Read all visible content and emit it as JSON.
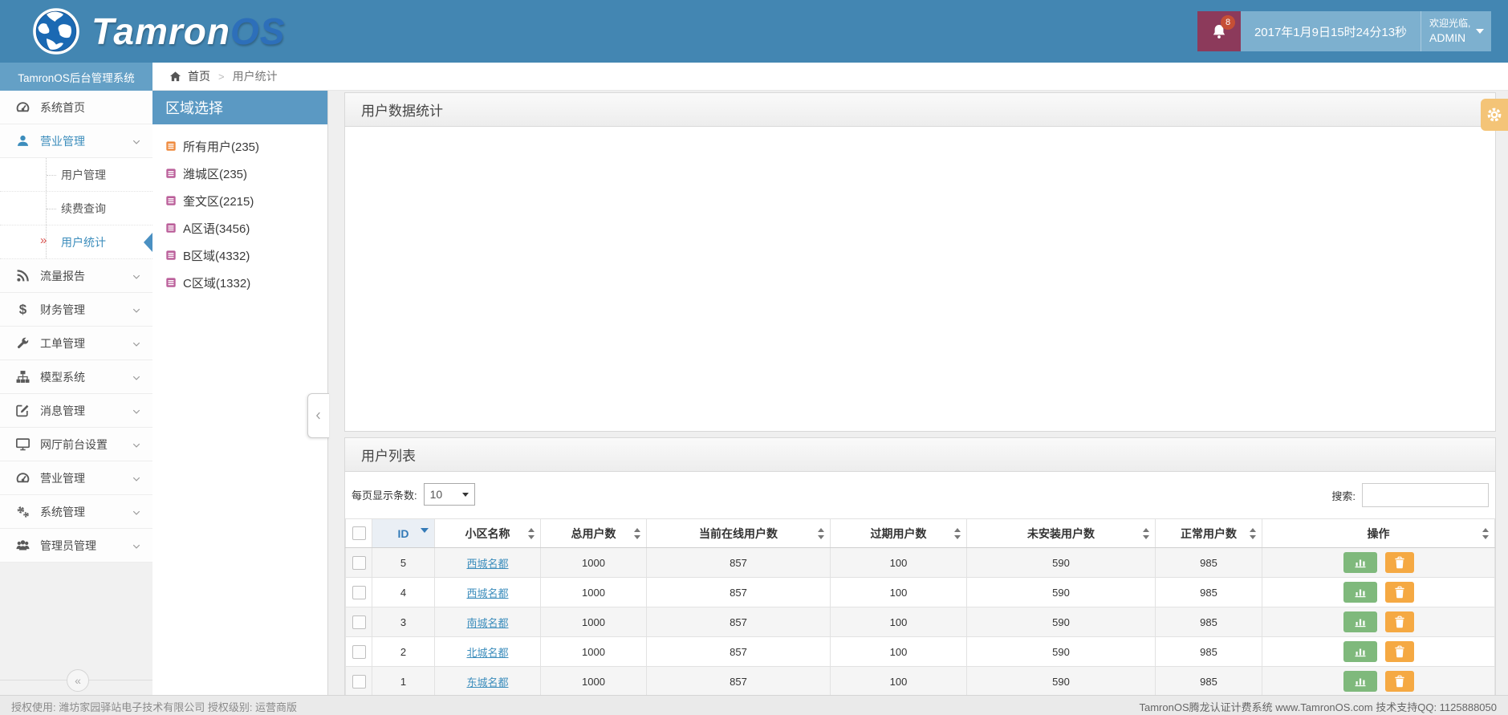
{
  "topbar": {
    "logo_text_primary": "Tamron",
    "logo_text_secondary": "OS",
    "notification_count": "8",
    "datetime": "2017年1月9日15时24分13秒",
    "welcome": "欢迎光临,",
    "username": "ADMIN"
  },
  "breadcrumb": {
    "home": "首页",
    "current": "用户统计"
  },
  "sidebar": {
    "title": "TamronOS后台管理系统",
    "items": [
      {
        "label": "系统首页",
        "icon": "dashboard",
        "type": "item",
        "expandable": false,
        "active": false
      },
      {
        "label": "营业管理",
        "icon": "user",
        "type": "item",
        "expandable": true,
        "active": true
      },
      {
        "label": "用户管理",
        "type": "sub",
        "active": false
      },
      {
        "label": "续费查询",
        "type": "sub",
        "active": false
      },
      {
        "label": "用户统计",
        "type": "sub",
        "active": true
      },
      {
        "label": "流量报告",
        "icon": "rss",
        "type": "item",
        "expandable": true,
        "active": false
      },
      {
        "label": "财务管理",
        "icon": "dollar",
        "type": "item",
        "expandable": true,
        "active": false
      },
      {
        "label": "工单管理",
        "icon": "wrench",
        "type": "item",
        "expandable": true,
        "active": false
      },
      {
        "label": "模型系统",
        "icon": "sitemap",
        "type": "item",
        "expandable": true,
        "active": false
      },
      {
        "label": "消息管理",
        "icon": "edit",
        "type": "item",
        "expandable": true,
        "active": false
      },
      {
        "label": "网厅前台设置",
        "icon": "monitor",
        "type": "item",
        "expandable": true,
        "active": false
      },
      {
        "label": "营业管理",
        "icon": "dashboard",
        "type": "item",
        "expandable": true,
        "active": false
      },
      {
        "label": "系统管理",
        "icon": "gears",
        "type": "item",
        "expandable": true,
        "active": false
      },
      {
        "label": "管理员管理",
        "icon": "users",
        "type": "item",
        "expandable": true,
        "active": false
      }
    ]
  },
  "region_panel": {
    "title": "区域选择",
    "items": [
      {
        "label": "所有用户(235)",
        "color": "#ef8b3f"
      },
      {
        "label": "潍城区(235)",
        "color": "#bb5f9a"
      },
      {
        "label": "奎文区(2215)",
        "color": "#bb5f9a"
      },
      {
        "label": "A区语(3456)",
        "color": "#bb5f9a"
      },
      {
        "label": "B区域(4332)",
        "color": "#bb5f9a"
      },
      {
        "label": "C区域(1332)",
        "color": "#bb5f9a"
      }
    ]
  },
  "stats_panel": {
    "title": "用户数据统计"
  },
  "list_panel": {
    "title": "用户列表",
    "page_size_label": "每页显示条数:",
    "page_size_value": "10",
    "search_label": "搜索:",
    "search_value": ""
  },
  "user_table": {
    "columns": [
      {
        "label": "",
        "type": "checkbox"
      },
      {
        "label": "ID",
        "type": "sorted-desc"
      },
      {
        "label": "小区名称",
        "type": "sortable"
      },
      {
        "label": "总用户数",
        "type": "sortable"
      },
      {
        "label": "当前在线用户数",
        "type": "sortable"
      },
      {
        "label": "过期用户数",
        "type": "sortable"
      },
      {
        "label": "未安装用户数",
        "type": "sortable"
      },
      {
        "label": "正常用户数",
        "type": "sortable"
      },
      {
        "label": "操作",
        "type": "sortable"
      }
    ],
    "rows": [
      {
        "id": "5",
        "name": "西城名都",
        "total": "1000",
        "online": "857",
        "expired": "100",
        "uninstalled": "590",
        "normal": "985"
      },
      {
        "id": "4",
        "name": "西城名都",
        "total": "1000",
        "online": "857",
        "expired": "100",
        "uninstalled": "590",
        "normal": "985"
      },
      {
        "id": "3",
        "name": "南城名都",
        "total": "1000",
        "online": "857",
        "expired": "100",
        "uninstalled": "590",
        "normal": "985"
      },
      {
        "id": "2",
        "name": "北城名都",
        "total": "1000",
        "online": "857",
        "expired": "100",
        "uninstalled": "590",
        "normal": "985"
      },
      {
        "id": "1",
        "name": "东城名都",
        "total": "1000",
        "online": "857",
        "expired": "100",
        "uninstalled": "590",
        "normal": "985"
      }
    ],
    "row_actions": [
      {
        "name": "chart-button",
        "icon": "chart",
        "color": "#7fb97c"
      },
      {
        "name": "delete-button",
        "icon": "trash",
        "color": "#f5a943"
      }
    ]
  },
  "footer": {
    "left": "授权使用: 潍坊家园驿站电子技术有限公司  授权级别: 运营商版",
    "right": "TamronOS腾龙认证计费系统 www.TamronOS.com 技术支持QQ: 1125888050"
  },
  "colors": {
    "header_blue": "#4386b2",
    "subheader_blue": "#64a0c6",
    "region_header_blue": "#5b99c3",
    "notification_maroon": "#8c3a5b",
    "badge_red": "#c64f35",
    "active_link_blue": "#3c8dbc",
    "sorted_header_blue": "#337ab7",
    "gear_tab_orange": "#f4c477",
    "chart_button_green": "#7fb97c",
    "delete_button_orange": "#f5a943",
    "tree_icon_orange": "#ef8b3f",
    "tree_icon_pink": "#bb5f9a"
  }
}
